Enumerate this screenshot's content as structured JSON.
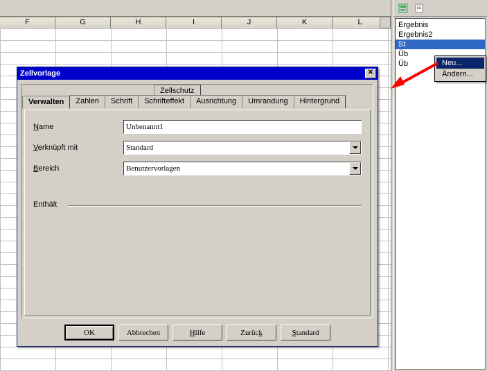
{
  "columns": [
    "F",
    "G",
    "H",
    "I",
    "J",
    "K",
    "L"
  ],
  "sidebar": {
    "styles": [
      "Ergebnis",
      "Ergebnis2",
      "St",
      "Üb",
      "Üb"
    ]
  },
  "context_menu": {
    "items": [
      "Neu...",
      "Ändern..."
    ],
    "highlighted": 0
  },
  "dialog": {
    "title": "Zellvorlage",
    "tabs_back": [
      "Zellschutz"
    ],
    "tabs_front": [
      "Verwalten",
      "Zahlen",
      "Schrift",
      "Schrifteffekt",
      "Ausrichtung",
      "Umrandung",
      "Hintergrund"
    ],
    "active_tab": 0,
    "fields": {
      "name_label": "Name",
      "name_value": "Unbenannt1",
      "linked_label": "Verknüpft mit",
      "linked_value": "Standard",
      "area_label": "Bereich",
      "area_value": "Benutzervorlagen",
      "contains_label": "Enthält"
    },
    "buttons": {
      "ok": "OK",
      "cancel": "Abbrechen",
      "help": "Hilfe",
      "back": "Zurück",
      "standard": "Standard"
    }
  }
}
